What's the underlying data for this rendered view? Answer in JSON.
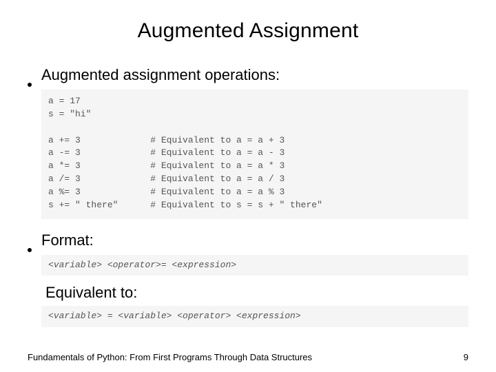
{
  "slide": {
    "title": "Augmented Assignment",
    "bullet1": "Augmented assignment operations:",
    "code1": "a = 17\ns = \"hi\"\n\na += 3             # Equivalent to a = a + 3\na -= 3             # Equivalent to a = a - 3\na *= 3             # Equivalent to a = a * 3\na /= 3             # Equivalent to a = a / 3\na %= 3             # Equivalent to a = a % 3\ns += \" there\"      # Equivalent to s = s + \" there\"",
    "bullet2": "Format:",
    "format_line": "<variable> <operator>= <expression>",
    "equiv_label": "Equivalent to:",
    "equiv_line": "<variable> = <variable> <operator> <expression>",
    "footer_text": "Fundamentals of Python: From First Programs Through Data Structures",
    "page_number": "9"
  }
}
